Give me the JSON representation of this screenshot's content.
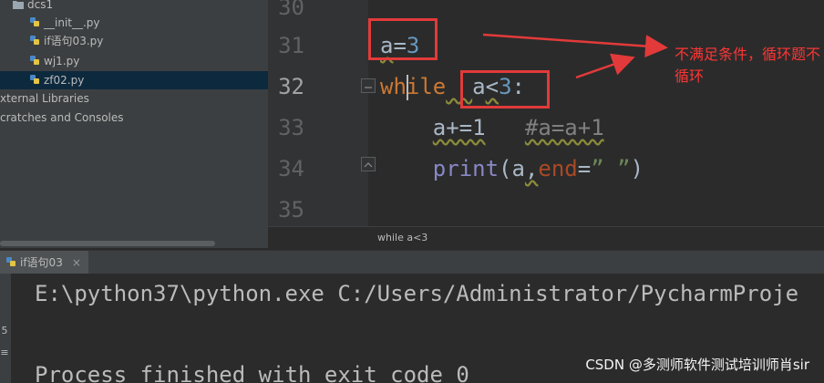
{
  "project_tree": {
    "items": [
      {
        "label": "dcs1",
        "type": "folder"
      },
      {
        "label": "__init__.py",
        "type": "python-file"
      },
      {
        "label": "if语句03.py",
        "type": "python-file"
      },
      {
        "label": "wj1.py",
        "type": "python-file"
      },
      {
        "label": "zf02.py",
        "type": "python-file",
        "selected": true
      },
      {
        "label": "xternal Libraries",
        "type": "library"
      },
      {
        "label": "cratches and Consoles",
        "type": "scratches"
      }
    ]
  },
  "editor": {
    "line_numbers": [
      "30",
      "31",
      "32",
      "33",
      "34",
      "35"
    ],
    "current_line": "32",
    "lines": [
      {
        "line": "31",
        "tokens": [
          {
            "t": "a",
            "c": "plain",
            "squig": true
          },
          {
            "t": "=",
            "c": "plain"
          },
          {
            "t": "3",
            "c": "num"
          }
        ]
      },
      {
        "line": "32",
        "tokens": [
          {
            "t": "while",
            "c": "kw"
          },
          {
            "t": "  ",
            "c": "plain",
            "squig": true
          },
          {
            "t": "a",
            "c": "plain"
          },
          {
            "t": "<",
            "c": "plain",
            "squig": true
          },
          {
            "t": "3",
            "c": "num"
          },
          {
            "t": ":",
            "c": "plain"
          }
        ]
      },
      {
        "line": "33",
        "tokens": [
          {
            "t": "    ",
            "c": "plain"
          },
          {
            "t": "a+=1",
            "c": "plain",
            "squig": true
          },
          {
            "t": "   ",
            "c": "plain"
          },
          {
            "t": "#a=a+1",
            "c": "cmt",
            "squig": true
          }
        ]
      },
      {
        "line": "34",
        "tokens": [
          {
            "t": "    ",
            "c": "plain"
          },
          {
            "t": "print",
            "c": "builtin"
          },
          {
            "t": "(a",
            "c": "plain"
          },
          {
            "t": ",",
            "c": "plain",
            "squig": true
          },
          {
            "t": "end",
            "c": "param"
          },
          {
            "t": "=",
            "c": "plain"
          },
          {
            "t": "” ”",
            "c": "str"
          },
          {
            "t": ")",
            "c": "plain"
          }
        ]
      }
    ],
    "breadcrumb": "while a<3"
  },
  "annotation": {
    "text": "不满足条件，循环题不循环"
  },
  "run_window": {
    "tab_label": "if语句03",
    "tab_close": "×",
    "sidebar_markers": [
      "5",
      "≡"
    ],
    "console_lines": [
      "E:\\python37\\python.exe C:/Users/Administrator/PycharmProje",
      "",
      "Process finished with exit code 0"
    ]
  },
  "watermark": "CSDN @多测师软件测试培训师肖sir",
  "colors": {
    "keyword": "#cc7832",
    "number": "#6897bb",
    "comment": "#808080",
    "string": "#6a8759",
    "annotation_red": "#e23a3a"
  }
}
